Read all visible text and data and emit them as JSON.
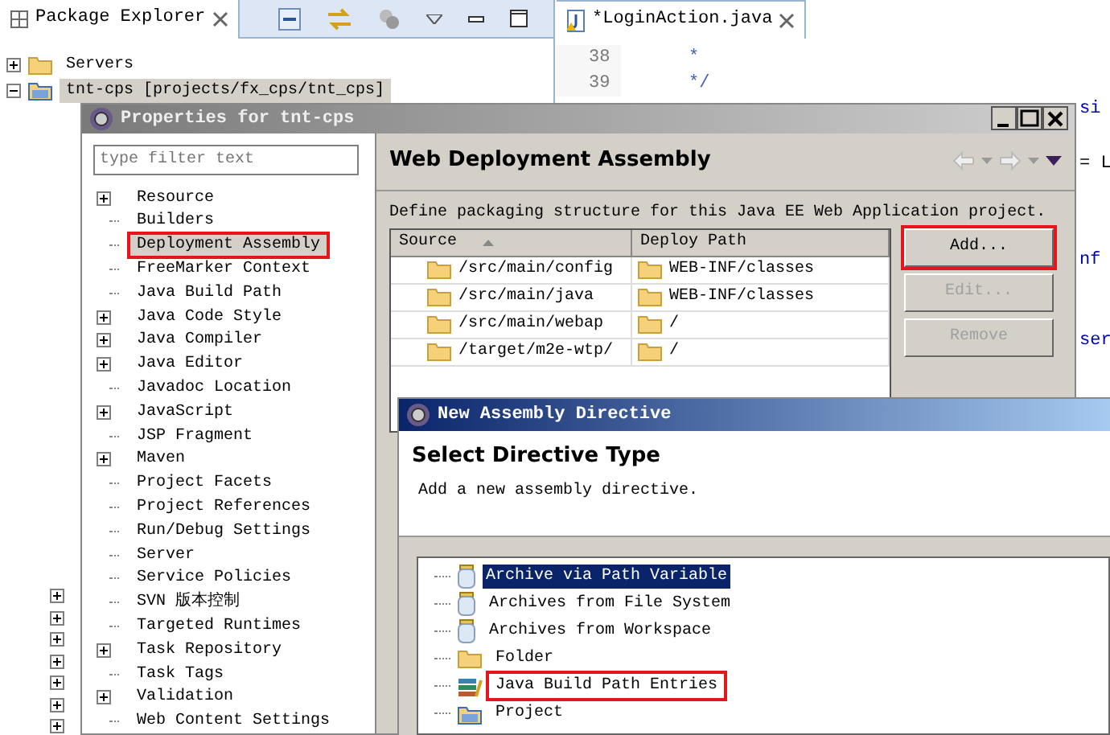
{
  "explorer": {
    "title": "Package Explorer",
    "tree": [
      {
        "label": "Servers",
        "kind": "folder",
        "expanded": false,
        "selected": false
      },
      {
        "label": "tnt-cps [projects/fx_cps/tnt_cps]",
        "kind": "project",
        "expanded": true,
        "selected": true
      }
    ],
    "hidden_nodes": [
      {
        "expanded": false
      },
      {
        "expanded": false
      },
      {
        "expanded": false
      },
      {
        "expanded": false
      },
      {
        "expanded": false
      },
      {
        "expanded": false
      },
      {
        "expanded": false
      }
    ]
  },
  "editor": {
    "tab": "*LoginAction.java",
    "lines": [
      {
        "number": "38",
        "code": "*"
      },
      {
        "number": "39",
        "code": "*/"
      }
    ],
    "fragments": [
      "si",
      "= L",
      "nf",
      "ser"
    ]
  },
  "properties_dialog": {
    "title": "Properties for tnt-cps",
    "filter": {
      "placeholder": "type filter text"
    },
    "tree": [
      {
        "label": "Resource",
        "expandable": true,
        "highlighted": false
      },
      {
        "label": "Builders",
        "expandable": false,
        "highlighted": false
      },
      {
        "label": "Deployment Assembly",
        "expandable": false,
        "highlighted": true
      },
      {
        "label": "FreeMarker Context",
        "expandable": false,
        "highlighted": false
      },
      {
        "label": "Java Build Path",
        "expandable": false,
        "highlighted": false
      },
      {
        "label": "Java Code Style",
        "expandable": true,
        "highlighted": false
      },
      {
        "label": "Java Compiler",
        "expandable": true,
        "highlighted": false
      },
      {
        "label": "Java Editor",
        "expandable": true,
        "highlighted": false
      },
      {
        "label": "Javadoc Location",
        "expandable": false,
        "highlighted": false
      },
      {
        "label": "JavaScript",
        "expandable": true,
        "highlighted": false
      },
      {
        "label": "JSP Fragment",
        "expandable": false,
        "highlighted": false
      },
      {
        "label": "Maven",
        "expandable": true,
        "highlighted": false
      },
      {
        "label": "Project Facets",
        "expandable": false,
        "highlighted": false
      },
      {
        "label": "Project References",
        "expandable": false,
        "highlighted": false
      },
      {
        "label": "Run/Debug Settings",
        "expandable": false,
        "highlighted": false
      },
      {
        "label": "Server",
        "expandable": false,
        "highlighted": false
      },
      {
        "label": "Service Policies",
        "expandable": false,
        "highlighted": false
      },
      {
        "label": "SVN 版本控制",
        "expandable": false,
        "highlighted": false
      },
      {
        "label": "Targeted Runtimes",
        "expandable": false,
        "highlighted": false
      },
      {
        "label": "Task Repository",
        "expandable": true,
        "highlighted": false
      },
      {
        "label": "Task Tags",
        "expandable": false,
        "highlighted": false
      },
      {
        "label": "Validation",
        "expandable": true,
        "highlighted": false
      },
      {
        "label": "Web Content Settings",
        "expandable": false,
        "highlighted": false
      }
    ],
    "page": {
      "title": "Web Deployment Assembly",
      "description": "Define packaging structure for this Java EE Web Application project.",
      "table": {
        "columns": [
          {
            "label": "Source",
            "sorted": true
          },
          {
            "label": "Deploy Path",
            "sorted": false
          }
        ],
        "rows": [
          [
            "/src/main/config",
            "WEB-INF/classes"
          ],
          [
            "/src/main/java",
            "WEB-INF/classes"
          ],
          [
            "/src/main/webap",
            "/"
          ],
          [
            "/target/m2e-wtp/",
            "/"
          ]
        ]
      },
      "buttons": [
        {
          "label": "Add...",
          "disabled": false,
          "highlighted": true
        },
        {
          "label": "Edit...",
          "disabled": true,
          "highlighted": false
        },
        {
          "label": "Remove",
          "disabled": true,
          "highlighted": false
        }
      ]
    }
  },
  "directive_dialog": {
    "title": "New Assembly Directive",
    "heading": "Select Directive Type",
    "description": "Add a new assembly directive.",
    "items": [
      {
        "label": "Archive via Path Variable",
        "kind": "jar",
        "selected": true,
        "highlighted": false
      },
      {
        "label": "Archives from File System",
        "kind": "jar",
        "selected": false,
        "highlighted": false
      },
      {
        "label": "Archives from Workspace",
        "kind": "jar",
        "selected": false,
        "highlighted": false
      },
      {
        "label": "Folder",
        "kind": "folder",
        "selected": false,
        "highlighted": false
      },
      {
        "label": "Java Build Path Entries",
        "kind": "library",
        "selected": false,
        "highlighted": true
      },
      {
        "label": "Project",
        "kind": "project",
        "selected": false,
        "highlighted": false
      }
    ]
  }
}
